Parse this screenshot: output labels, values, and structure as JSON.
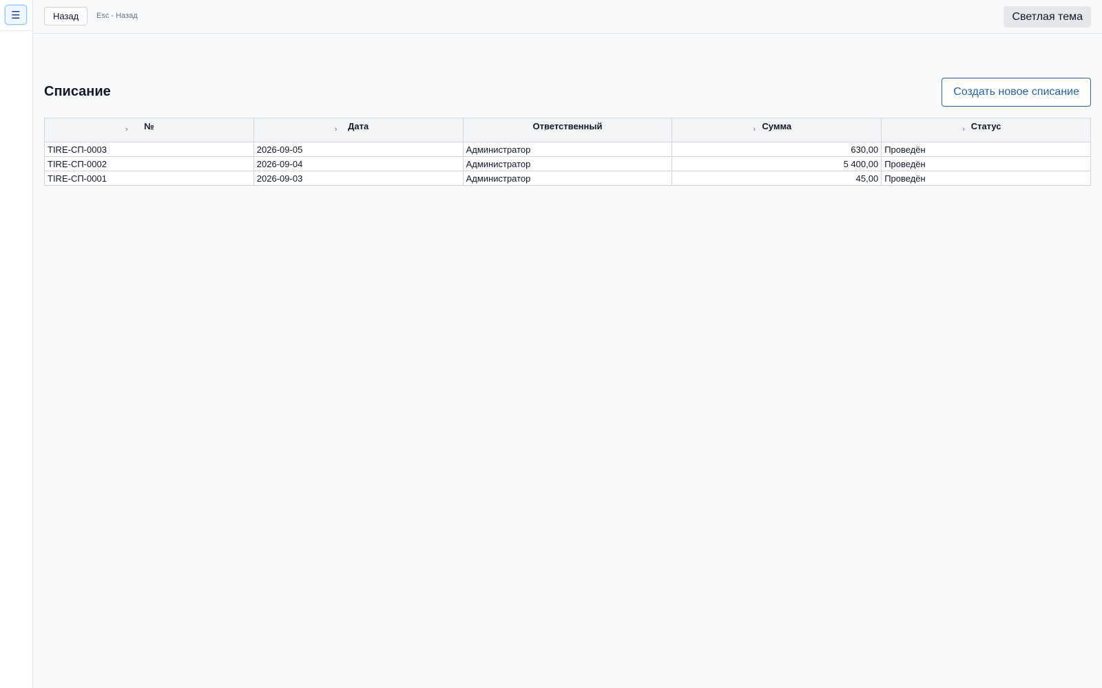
{
  "sidebar": {
    "menu_icon": "☰"
  },
  "topbar": {
    "back_label": "Назад",
    "hint": "Esc - Назад",
    "theme_label": "Светлая тема"
  },
  "page": {
    "title": "Списание",
    "create_label": "Создать новое списание"
  },
  "table": {
    "columns": [
      {
        "label": "№",
        "sort_icon": "›"
      },
      {
        "label": "Дата",
        "sort_icon": "›"
      },
      {
        "label": "Ответственный",
        "sort_icon": "›"
      },
      {
        "label": "Сумма",
        "sort_icon": "›"
      },
      {
        "label": "Статус",
        "sort_icon": "›"
      }
    ],
    "rows": [
      {
        "number": "TIRE-СП-0003",
        "date": "2026-09-05",
        "responsible": "Администратор",
        "sum": "630,00",
        "status": "Проведён"
      },
      {
        "number": "TIRE-СП-0002",
        "date": "2026-09-04",
        "responsible": "Администратор",
        "sum": "5 400,00",
        "status": "Проведён"
      },
      {
        "number": "TIRE-СП-0001",
        "date": "2026-09-03",
        "responsible": "Администратор",
        "sum": "45,00",
        "status": "Проведён"
      }
    ]
  }
}
